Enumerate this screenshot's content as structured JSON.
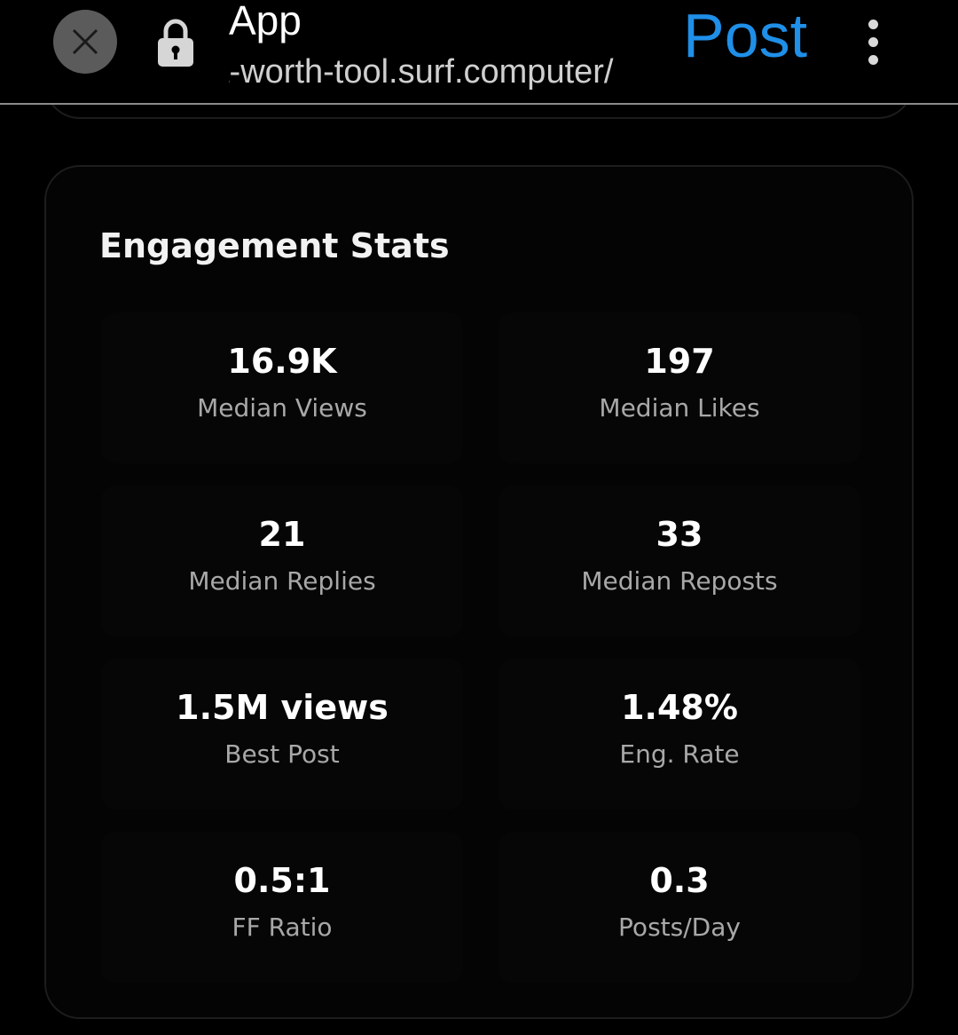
{
  "browser": {
    "title": "App",
    "url": "t-worth-tool.surf.computer/",
    "post_label": "Post",
    "icons": {
      "close": "close-icon",
      "lock": "lock-icon",
      "menu": "more-vertical-icon"
    }
  },
  "card": {
    "title": "Engagement Stats"
  },
  "stats": [
    {
      "value": "16.9K",
      "label": "Median Views"
    },
    {
      "value": "197",
      "label": "Median Likes"
    },
    {
      "value": "21",
      "label": "Median Replies"
    },
    {
      "value": "33",
      "label": "Median Reposts"
    },
    {
      "value": "1.5M views",
      "label": "Best Post"
    },
    {
      "value": "1.48%",
      "label": "Eng. Rate"
    },
    {
      "value": "0.5:1",
      "label": "FF Ratio"
    },
    {
      "value": "0.3",
      "label": "Posts/Day"
    }
  ],
  "colors": {
    "accent": "#1f8fe8",
    "background": "#000000",
    "label": "#a8a8a8"
  }
}
